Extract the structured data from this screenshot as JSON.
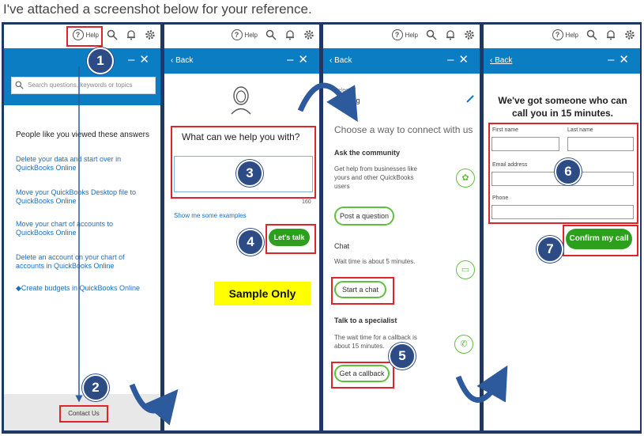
{
  "caption": "I've attached a screenshot below for your reference.",
  "topbar": {
    "help_label": "Help"
  },
  "panel1": {
    "search_placeholder": "Search questions, keywords or topics",
    "heading": "People like you viewed these answers",
    "links": [
      "Delete your data and start over in QuickBooks Online",
      "Move your QuickBooks Desktop file to QuickBooks Online",
      "Move your chart of accounts to QuickBooks Online",
      "Delete an account on your chart of accounts in QuickBooks Online",
      "◆Create budgets in QuickBooks Online"
    ],
    "contact_button": "Contact Us"
  },
  "panel2": {
    "back_label": "‹ Back",
    "question": "What can we help you with?",
    "char_count": "160",
    "examples_link": "Show me some examples",
    "talk_button": "Let's talk",
    "sample_label": "Sample Only"
  },
  "panel3": {
    "back_label": "‹ Back",
    "selected_small": "Selected",
    "selected_value": "Banking",
    "title": "Choose a way to connect with us",
    "community_title": "Ask the community",
    "community_desc": "Get help from businesses like yours and other QuickBooks users",
    "post_button": "Post a question",
    "chat_title": "Chat",
    "chat_desc": "Wait time is about 5 minutes.",
    "chat_button": "Start a chat",
    "specialist_title": "Talk to a specialist",
    "specialist_desc": "The wait time for a callback is about 15 minutes.",
    "callback_button": "Get a callback"
  },
  "panel4": {
    "back_label": "‹ Back",
    "title": "We've got someone who can call you in 15 minutes.",
    "first_name_label": "First name",
    "last_name_label": "Last name",
    "email_label": "Email address",
    "phone_label": "Phone",
    "confirm_button": "Confirm my call"
  },
  "badges": [
    "1",
    "2",
    "3",
    "4",
    "5",
    "6",
    "7"
  ],
  "colors": {
    "header_blue": "#0b7dc2",
    "frame_navy": "#1e3764",
    "badge_navy": "#2d4c86",
    "qb_green": "#2ca01c",
    "highlight_red": "#e0242c",
    "sample_yellow": "#ffff00"
  },
  "icons": [
    "help-icon",
    "search-icon",
    "bell-icon",
    "gear-icon",
    "minimize-icon",
    "close-icon",
    "user-avatar-icon",
    "community-icon",
    "chat-icon",
    "phone-icon",
    "edit-pencil-icon"
  ]
}
